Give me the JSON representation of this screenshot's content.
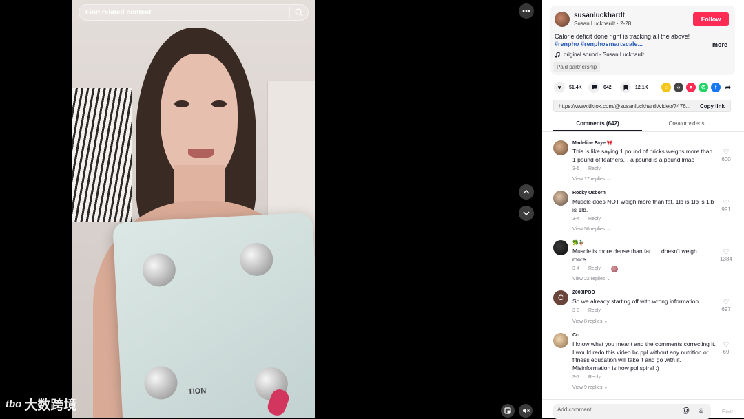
{
  "video": {
    "search_placeholder": "Find related content",
    "scale_text": "TION",
    "watermark": "大数跨境",
    "watermark_logo": "tbo"
  },
  "icons": {
    "search": "search-icon",
    "more": "more-horizontal-icon",
    "up": "chevron-up-icon",
    "down": "chevron-down-icon",
    "miniplayer": "mini-player-icon",
    "mute": "volume-mute-icon"
  },
  "post": {
    "username": "susanluckhardt",
    "display": "Susan Luckhardt · 2-28",
    "follow_label": "Follow",
    "caption": "Calorie deficit done right is tracking all the above!",
    "hashtags": "#renpho #renphosmartscale...",
    "more_label": "more",
    "sound": "original sound - Susan Luckhardt",
    "paid": "Paid partnership"
  },
  "stats": {
    "likes": "51.4K",
    "comments": "642",
    "saves": "12.1K"
  },
  "link": {
    "url": "https://www.tiktok.com/@susanluckhardt/video/7476...",
    "copy_label": "Copy link"
  },
  "tabs": [
    {
      "label": "Comments (642)"
    },
    {
      "label": "Creator videos"
    }
  ],
  "comments": [
    {
      "name": "Madeline Faye 🎀",
      "text": "This is like saying 1 pound of bricks weighs more than 1 pound of feathers… a pound is a pound lmao",
      "date": "3-5",
      "reply": "Reply",
      "view": "View 17 replies ⌄",
      "likes": "600"
    },
    {
      "name": "Rocky Osborn",
      "text": "Muscle does NOT weigh more than fat. 1lb is 1lb is 1lb is 1lb.",
      "date": "3-4",
      "reply": "Reply",
      "view": "View 56 replies ⌄",
      "likes": "991"
    },
    {
      "name": "🥦🦆",
      "text": "Muscle is more dense than fat….. doesn't weigh more…..",
      "date": "3-4",
      "reply": "Reply",
      "view": "View 22 replies ⌄",
      "likes": "1384"
    },
    {
      "name": "2009IPOD",
      "text": "So we already starting off with wrong information",
      "date": "3-3",
      "reply": "Reply",
      "view": "View 8 replies ⌄",
      "likes": "697",
      "initial": "C"
    },
    {
      "name": "Cc",
      "text": "I know what you meant and the comments correcting it. I would redo this video bc ppl without any nutrition or fitness education will take it and go with it. Misinformation is how ppl spiral :)",
      "date": "3-7",
      "reply": "Reply",
      "view": "View 9 replies ⌄",
      "likes": "69"
    }
  ],
  "composer": {
    "placeholder": "Add comment...",
    "post_label": "Post"
  },
  "colors": {
    "follow": "#fe2c55",
    "hashtag": "#2b5db9"
  }
}
